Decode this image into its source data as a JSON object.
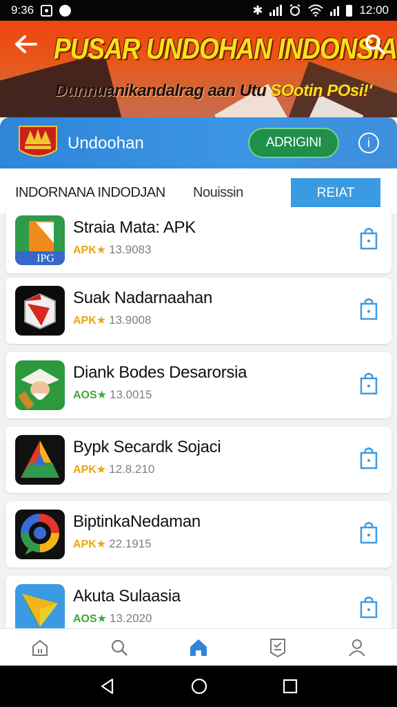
{
  "status_bar": {
    "time_left": "9:36",
    "time_right": "12:00",
    "bluetooth_glyph": "✱"
  },
  "banner": {
    "title": "PUSAR UNDOHAN INDONSIA",
    "subtitle_main": "Dunnuanikandalrag aan Utu ",
    "subtitle_highlight": "SOotin POsi!'"
  },
  "app_header": {
    "name": "Undoohan",
    "register_label": "ADRIGINI",
    "info_glyph": "i",
    "accent_color": "#3b95e4"
  },
  "filter": {
    "label_left": "INDORNANA INDODJAN",
    "label_right": "Nouissin",
    "button_label": "REIAT"
  },
  "apps": [
    {
      "title": "Straia Mata: APK",
      "badge": "APK★",
      "size": "13.9083",
      "icon": "pg-book-icon",
      "badge_color": "#e8a514"
    },
    {
      "title": "Suak Nadarnaahan",
      "badge": "APK★",
      "size": "13.9008",
      "icon": "shield-box-icon",
      "badge_color": "#e8a514"
    },
    {
      "title": "Diank Bodes Desarorsia",
      "badge": "AOS★",
      "size": "13.0015",
      "icon": "character-face-icon",
      "badge_color": "#3aa83a"
    },
    {
      "title": "Bypk Secardk Sojaci",
      "badge": "APK★",
      "size": "12.8.210",
      "icon": "triangle-a-icon",
      "badge_color": "#e8a514"
    },
    {
      "title": "BiptinkaNedaman",
      "badge": "APK★",
      "size": "22.1915",
      "icon": "location-ring-icon",
      "badge_color": "#e8a514"
    },
    {
      "title": "Akuta Sulaasia",
      "badge": "AOS★",
      "size": "13.2020",
      "icon": "folded-arrow-icon",
      "badge_color": "#3aa83a"
    }
  ],
  "bottom_nav": [
    "home-icon",
    "search-icon",
    "house-active-icon",
    "badge-icon",
    "profile-icon"
  ],
  "system_nav": [
    "back-icon",
    "home-circle-icon",
    "recents-icon"
  ]
}
